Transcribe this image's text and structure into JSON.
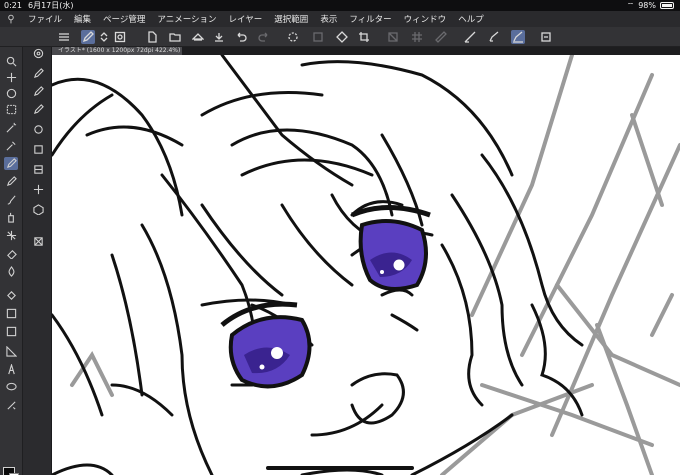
{
  "status": {
    "time": "0:21",
    "date": "6月17日(水)",
    "battery": "98%"
  },
  "menu": [
    "ファイル",
    "編集",
    "ページ管理",
    "アニメーション",
    "レイヤー",
    "選択範囲",
    "表示",
    "フィルター",
    "ウィンドウ",
    "ヘルプ"
  ],
  "document_tab": "イラスト* (1600 x 1200px 72dpi 422.4%)",
  "colors": {
    "ui_dark": "#333336",
    "active": "#5a6e9c",
    "line": "#111111",
    "sketch_gray": "#9a9a9a",
    "eye_purple": "#5a3fc0"
  },
  "toolbar_icons": [
    "menu-icon",
    "pen-mode-icon",
    "scroll-arrows-icon",
    "snap-icon",
    "new-page-icon",
    "open-icon",
    "save-icon",
    "print-icon",
    "export-icon",
    "undo-icon",
    "redo-icon",
    "loading-icon",
    "transform-icon",
    "fill-icon",
    "crop-icon",
    "clear-icon",
    "grid-icon",
    "ruler-icon",
    "stabilizer-icon",
    "pen-pressure-icon",
    "active-pen-icon",
    "settings-icon"
  ],
  "tool_icons": [
    "zoom-icon",
    "move-icon",
    "navigator-icon",
    "select-rect-icon",
    "magic-wand-icon",
    "eyedropper-icon",
    "pen-icon",
    "pencil-icon",
    "brush-icon",
    "airbrush-icon",
    "decoration-icon",
    "eraser-icon",
    "blend-icon",
    "fill-icon",
    "gradient-icon",
    "shape-icon",
    "ruler-icon",
    "text-icon",
    "balloon-icon",
    "correction-icon"
  ],
  "subtool_icons": [
    "subtool-1-icon",
    "subtool-2-icon",
    "subtool-3-icon",
    "subtool-4-icon",
    "subtool-5-icon",
    "subtool-6-icon",
    "subtool-7-icon",
    "subtool-8-icon",
    "subtool-9-icon",
    "subtool-10-icon"
  ]
}
